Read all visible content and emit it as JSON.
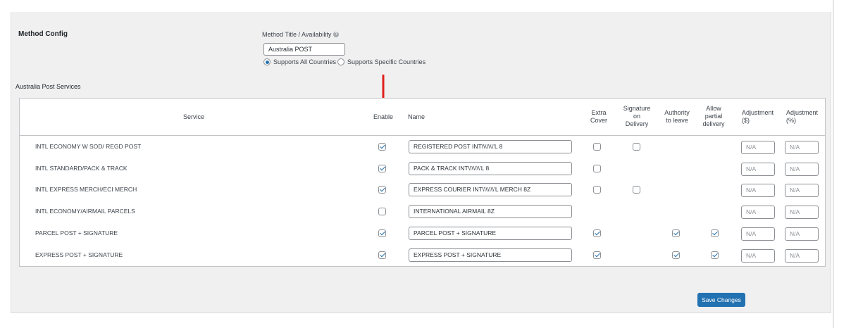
{
  "method_config": {
    "heading": "Method Config",
    "title_label": "Method Title / Availability",
    "title_value": "Australia POST",
    "availability": {
      "option_all": "Supports All Countries",
      "option_specific": "Supports Specific Countries",
      "selected": "all"
    }
  },
  "services": {
    "heading": "Australia Post Services",
    "columns": {
      "service": "Service",
      "enable": "Enable",
      "name": "Name",
      "extra_cover": [
        "Extra",
        "Cover"
      ],
      "signature": [
        "Signature",
        "on",
        "Delivery"
      ],
      "authority": [
        "Authority",
        "to leave"
      ],
      "partial": [
        "Allow",
        "partial",
        "delivery"
      ],
      "adj_dollar": [
        "Adjustment",
        "($)"
      ],
      "adj_percent": [
        "Adjustment",
        "(%)"
      ]
    },
    "rows": [
      {
        "service": "INTL ECONOMY W SOD/ REGD POST",
        "enabled": true,
        "name": "REGISTERED POST INT\\\\\\\\\\\\\\'L 8",
        "extra_cover": false,
        "signature": false,
        "authority": null,
        "partial": null,
        "adj_dollar": "N/A",
        "adj_percent": "N/A"
      },
      {
        "service": "INTL STANDARD/PACK & TRACK",
        "enabled": true,
        "name": "PACK & TRACK INT\\\\\\\\\\\\\\'L 8",
        "extra_cover": false,
        "signature": null,
        "authority": null,
        "partial": null,
        "adj_dollar": "N/A",
        "adj_percent": "N/A"
      },
      {
        "service": "INTL EXPRESS MERCH/ECI MERCH",
        "enabled": true,
        "name": "EXPRESS COURIER INT\\\\\\\\\\\\\\'L MERCH 8Z",
        "extra_cover": false,
        "signature": false,
        "authority": null,
        "partial": null,
        "adj_dollar": "N/A",
        "adj_percent": "N/A"
      },
      {
        "service": "INTL ECONOMY/AIRMAIL PARCELS",
        "enabled": false,
        "name": "INTERNATIONAL AIRMAIL 8Z",
        "extra_cover": null,
        "signature": null,
        "authority": null,
        "partial": null,
        "adj_dollar": "N/A",
        "adj_percent": "N/A"
      },
      {
        "service": "PARCEL POST + SIGNATURE",
        "enabled": true,
        "name": "PARCEL POST + SIGNATURE",
        "extra_cover": true,
        "signature": null,
        "authority": true,
        "partial": true,
        "adj_dollar": "N/A",
        "adj_percent": "N/A"
      },
      {
        "service": "EXPRESS POST + SIGNATURE",
        "enabled": true,
        "name": "EXPRESS POST + SIGNATURE",
        "extra_cover": true,
        "signature": null,
        "authority": true,
        "partial": true,
        "adj_dollar": "N/A",
        "adj_percent": "N/A"
      }
    ]
  },
  "save_label": "Save Changes",
  "colors": {
    "accent": "#2271b1",
    "arrow": "#e0201c",
    "background": "#f0f0f1"
  },
  "icons": {
    "help": "help-circle-icon",
    "annotation": "red-down-arrow-icon"
  }
}
